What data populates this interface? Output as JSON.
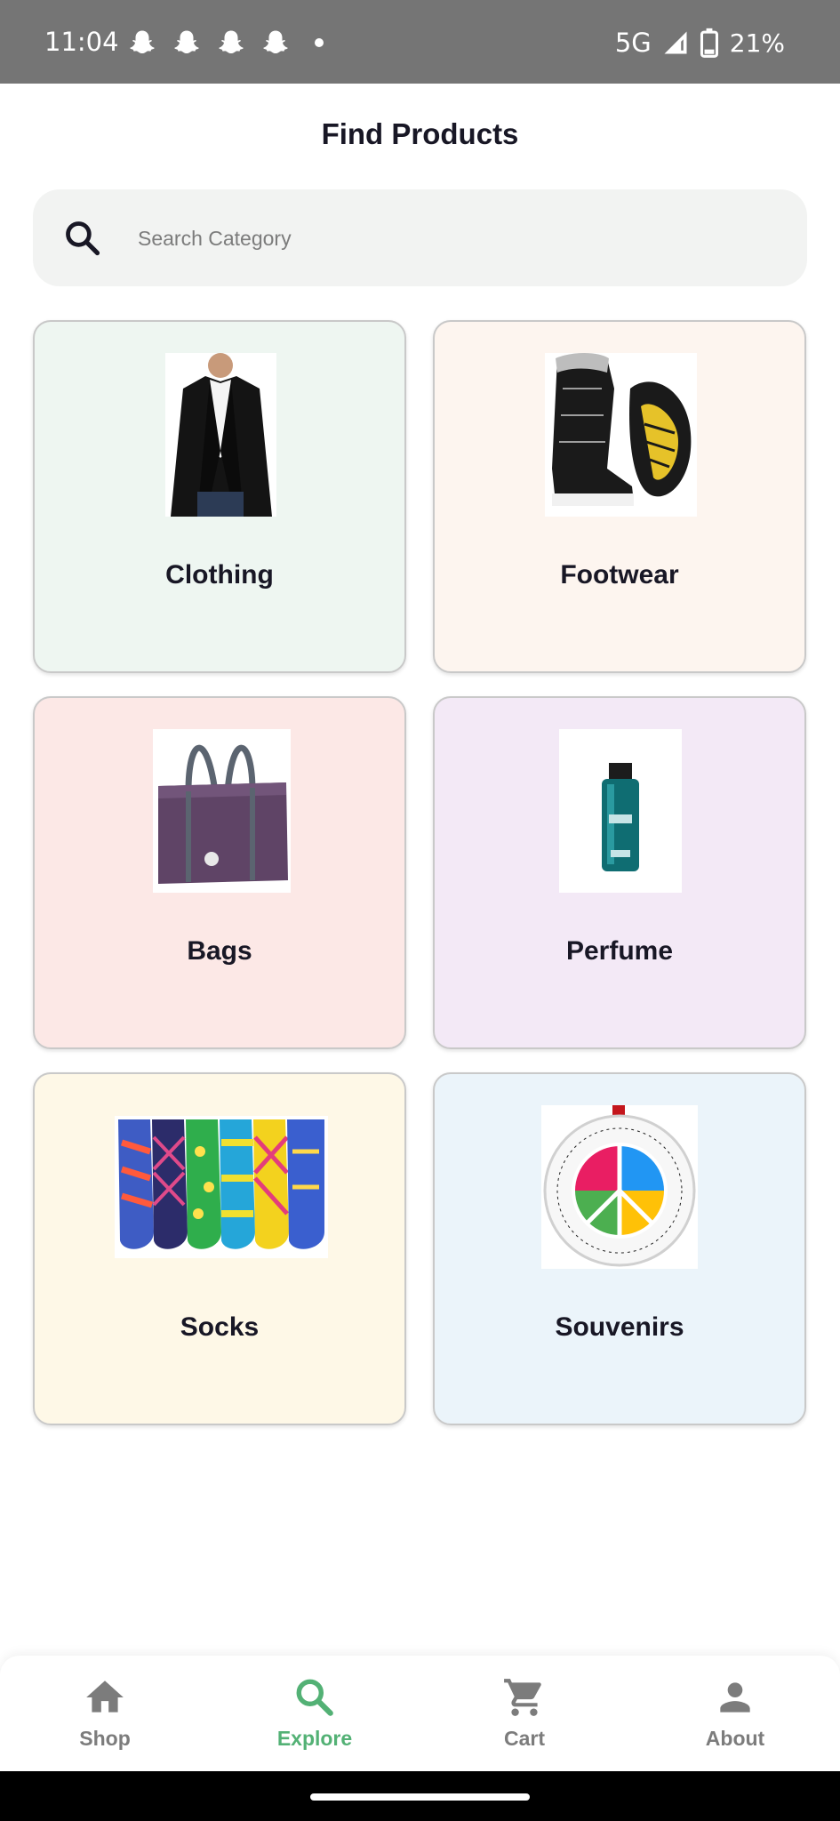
{
  "status_bar": {
    "time": "11:04",
    "network": "5G",
    "battery": "21%",
    "notification_icons": [
      "snapchat-icon",
      "snapchat-icon",
      "snapchat-icon",
      "snapchat-icon",
      "more-dot"
    ]
  },
  "header": {
    "title": "Find Products"
  },
  "search": {
    "placeholder": "Search Category",
    "value": ""
  },
  "categories": [
    {
      "label": "Clothing",
      "bg": "#eef6f1",
      "image": "black-cardigan-image"
    },
    {
      "label": "Footwear",
      "bg": "#fdf5ef",
      "image": "winter-boots-image"
    },
    {
      "label": "Bags",
      "bg": "#fce8e6",
      "image": "purple-duffel-bag-image"
    },
    {
      "label": "Perfume",
      "bg": "#f3e9f6",
      "image": "teal-perfume-bottle-image"
    },
    {
      "label": "Socks",
      "bg": "#fef8e7",
      "image": "colorful-socks-image"
    },
    {
      "label": "Souvenirs",
      "bg": "#ebf4fa",
      "image": "peace-ornament-image"
    }
  ],
  "bottom_nav": {
    "items": [
      {
        "label": "Shop",
        "icon": "home-icon",
        "active": false
      },
      {
        "label": "Explore",
        "icon": "search-icon",
        "active": true
      },
      {
        "label": "Cart",
        "icon": "cart-icon",
        "active": false
      },
      {
        "label": "About",
        "icon": "person-icon",
        "active": false
      }
    ],
    "active_color": "#53b175",
    "inactive_color": "#7c7c7c"
  }
}
